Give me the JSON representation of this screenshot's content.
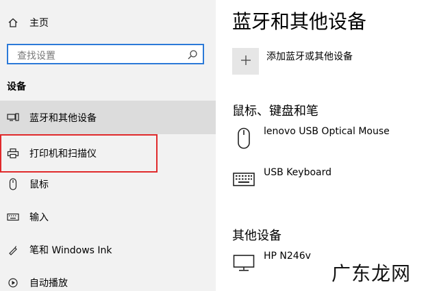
{
  "sidebar": {
    "home": {
      "label": "主页",
      "icon": "home-icon"
    },
    "search": {
      "placeholder": "查找设置",
      "icon": "search-icon"
    },
    "section_title": "设备",
    "items": [
      {
        "label": "蓝牙和其他设备",
        "icon": "bluetooth-devices-icon",
        "selected": true
      },
      {
        "label": "打印机和扫描仪",
        "icon": "printer-icon",
        "highlighted": true
      },
      {
        "label": "鼠标",
        "icon": "mouse-icon"
      },
      {
        "label": "输入",
        "icon": "keyboard-icon"
      },
      {
        "label": "笔和 Windows Ink",
        "icon": "pen-icon"
      },
      {
        "label": "自动播放",
        "icon": "autoplay-icon"
      }
    ]
  },
  "main": {
    "title": "蓝牙和其他设备",
    "add_device_label": "添加蓝牙或其他设备",
    "sections": [
      {
        "title": "鼠标、键盘和笔",
        "devices": [
          {
            "name": "lenovo USB Optical Mouse",
            "icon": "mouse-icon"
          },
          {
            "name": "USB Keyboard",
            "icon": "keyboard-icon"
          }
        ]
      },
      {
        "title": "其他设备",
        "devices": [
          {
            "name": "HP N246v",
            "icon": "monitor-icon"
          }
        ]
      }
    ]
  },
  "watermark": "广东龙网",
  "colors": {
    "sidebar_bg": "#f2f2f2",
    "selected_bg": "#dcdcdc",
    "search_border": "#2b79d8",
    "highlight": "#e0292b"
  }
}
